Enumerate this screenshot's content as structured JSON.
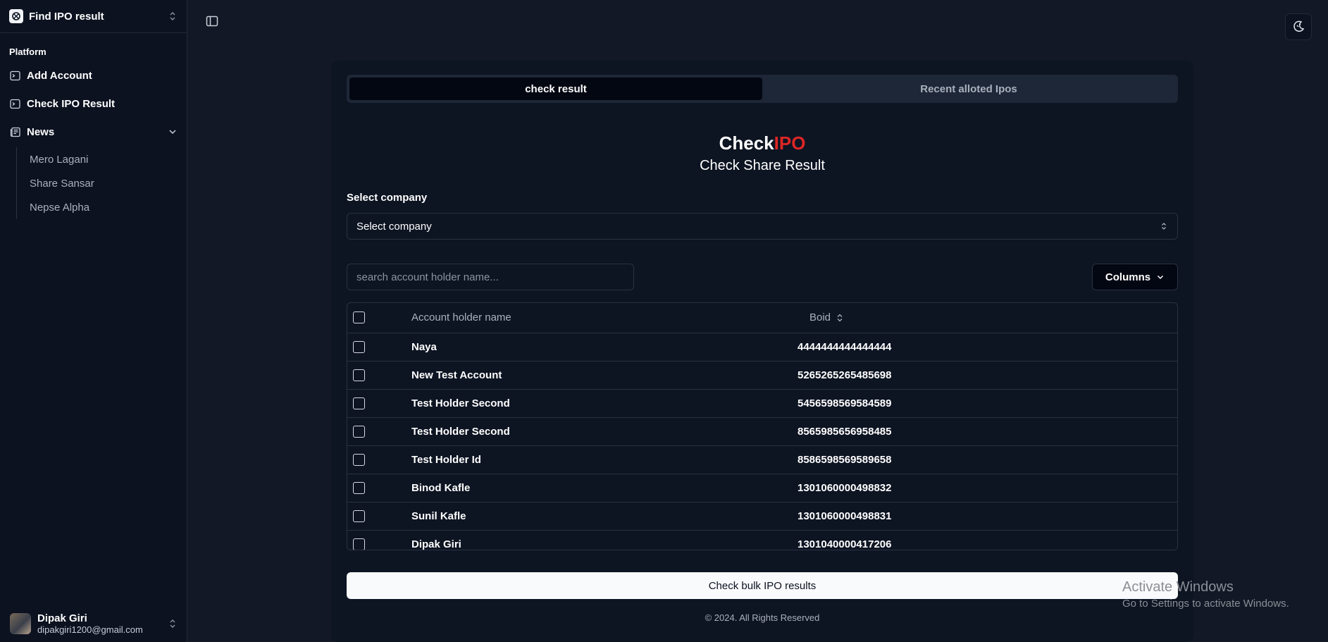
{
  "sidebar": {
    "brand": "Find IPO result",
    "group_label": "Platform",
    "items": [
      {
        "label": "Add Account"
      },
      {
        "label": "Check IPO Result"
      },
      {
        "label": "News"
      }
    ],
    "news_sub": [
      "Mero Lagani",
      "Share Sansar",
      "Nepse Alpha"
    ],
    "user": {
      "name": "Dipak Giri",
      "email": "dipakgiri1200@gmail.com"
    }
  },
  "tabs": [
    "check result",
    "Recent alloted Ipos"
  ],
  "heading": {
    "part1": "Check",
    "part2": "IPO",
    "subtitle": "Check Share Result"
  },
  "company": {
    "label": "Select company",
    "value": "Select company"
  },
  "search": {
    "placeholder": "search account holder name..."
  },
  "columns_button": "Columns",
  "table": {
    "headers": [
      "Account holder name",
      "Boid"
    ],
    "rows": [
      {
        "name": "Naya",
        "boid": "4444444444444444"
      },
      {
        "name": "New Test Account",
        "boid": "5265265265485698"
      },
      {
        "name": "Test Holder Second",
        "boid": "5456598569584589"
      },
      {
        "name": "Test Holder Second",
        "boid": "8565985656958485"
      },
      {
        "name": "Test Holder Id",
        "boid": "8586598569589658"
      },
      {
        "name": "Binod Kafle",
        "boid": "1301060000498832"
      },
      {
        "name": "Sunil Kafle",
        "boid": "1301060000498831"
      },
      {
        "name": "Dipak Giri",
        "boid": "1301040000417206"
      }
    ]
  },
  "bulk_button": "Check bulk IPO results",
  "footer": "© 2024. All Rights Reserved",
  "watermark": {
    "line1": "Activate Windows",
    "line2": "Go to Settings to activate Windows."
  },
  "colors": {
    "accent_red": "#dc2626",
    "background": "#121826",
    "sidebar": "#0c1220"
  }
}
